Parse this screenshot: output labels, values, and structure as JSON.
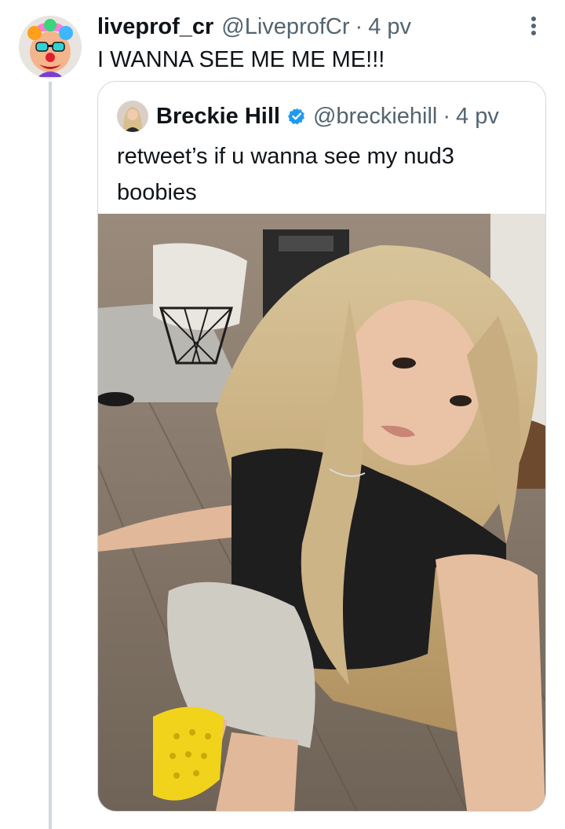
{
  "tweet": {
    "author_name": "liveprof_cr",
    "handle": "@LiveprofCr",
    "separator": "·",
    "time": "4 pv",
    "text": "I WANNA SEE ME ME ME!!!",
    "avatar_icon": "clown-avatar-icon",
    "more_icon": "more-vertical-icon"
  },
  "quote": {
    "author_name": "Breckie Hill",
    "verified": true,
    "verified_color": "#1d9bf0",
    "handle": "@breckiehill",
    "separator": "·",
    "time": "4 pv",
    "text": "retweet’s if u wanna see my nud3 boobies",
    "media_icon": "photo-media"
  },
  "colors": {
    "text_primary": "#0f1419",
    "text_secondary": "#536471",
    "border": "#cfd9de",
    "thread_line": "#cfd9de"
  }
}
